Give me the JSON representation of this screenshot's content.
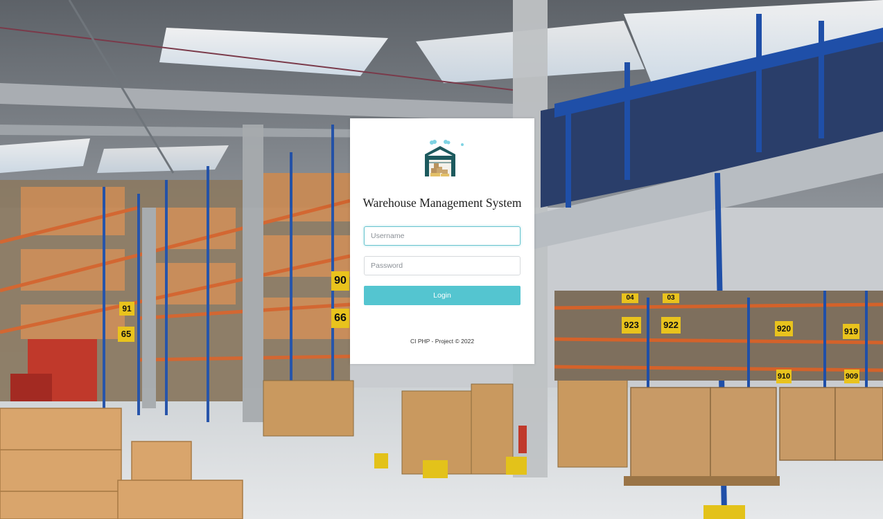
{
  "login": {
    "title": "Warehouse Management System",
    "username_placeholder": "Username",
    "password_placeholder": "Password",
    "login_label": "Login",
    "footer": "CI PHP - Project © 2022"
  },
  "background": {
    "rack_signs": [
      "90",
      "66",
      "65",
      "91",
      "923",
      "922",
      "920",
      "919",
      "910",
      "909",
      "04",
      "03"
    ]
  },
  "colors": {
    "accent": "#54c5d0",
    "rack_blue": "#1f4fa8",
    "beam_orange": "#d4622a",
    "logo_teal": "#1d5a5e"
  }
}
